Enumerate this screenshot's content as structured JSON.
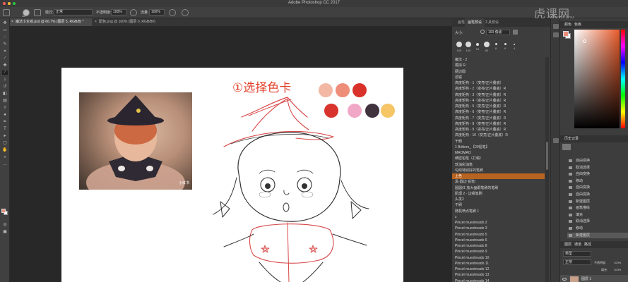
{
  "window": {
    "title": "Adobe Photoshop CC 2017",
    "traffic_colors": [
      "#fe5f57",
      "#febc2e",
      "#28c840"
    ]
  },
  "options_bar": {
    "brush_size": "100",
    "mode_label": "模式:",
    "mode_value": "正常",
    "opacity_label": "不透明度:",
    "opacity_value": "100%",
    "flow_label": "流量:",
    "flow_value": "100%"
  },
  "watermark": {
    "text": "虎课网",
    "sub": "HUKE88.COM"
  },
  "tabs": [
    {
      "label": "魔法小女孩.psd @ 66.7% (图层 5, RGB/8) *",
      "active": true
    },
    {
      "label": "配色.png @ 100% (图层 0, RGB/8#)",
      "active": false
    }
  ],
  "canvas": {
    "heading": "①选择色卡",
    "photo_caption": "小红书",
    "color_cards": [
      "#f2b8a4",
      "#ee8d78",
      "#d9322a",
      "#d8332c",
      "#f1a8c6",
      "#40333e",
      "#f6c565"
    ]
  },
  "brush_panel": {
    "tabs": [
      {
        "label": "画笔",
        "active": false
      },
      {
        "label": "画笔预设",
        "active": true
      },
      {
        "label": "工具预设",
        "active": false
      }
    ],
    "size_label": "大小:",
    "size_value": "100 像素",
    "presets": [
      "100",
      "100",
      "15",
      "60",
      "8",
      "9",
      "4"
    ],
    "items": [
      "魔法 - 2",
      "模拟 R",
      "硬边圆",
      "滤镜",
      "高度矩构 - 1（变亮/正片叠底）",
      "高度矩构 - 2（变亮/正片叠底）R",
      "高度矩构 - 3（变亮/正片叠底）R",
      "高度矩构 - 4（变亮/正片叠底）R",
      "高度矩构 - 5（变亮/正片叠底）R",
      "高度矩构 - 6（变亮/正片叠底）R",
      "高度矩构 - 7（变亮/正片叠底）R",
      "高度矩构 - 8（变亮/正片叠底）R",
      "高度矩构 - 9（变亮/正片叠底）R",
      "高度矩构 - 10（变亮/正片叠底）R",
      "干刷",
      "1 Brittern_【29铅笔】",
      "MAOMAO",
      "细密铅笔（打稿）",
      "软油彩油笔",
      "勾线特别好的笔刷",
      "上色",
      "黑-圆边 铅笔!",
      "圆圆红 放大面跟笔刷的笔刷",
      "肌理 2 - 边缘笔刷",
      "头发2",
      "干刷",
      "随机喷点笔刷 1",
      "z",
      "Pincel muestreado 2",
      "Pincel muestreado 3",
      "Pincel muestreado 5",
      "Pincel muestreado 6",
      "Pincel muestreado 8",
      "Pincel muestreado 9",
      "Pincel muestreado 10",
      "Pincel muestreado 11",
      "Pincel muestreado 12",
      "Pincel muestreado 13",
      "Pincel muestreado 14",
      "Pincel muestreado 15"
    ],
    "selected_index": 20
  },
  "color_panel": {
    "tabs": [
      "颜色",
      "色板"
    ],
    "foreground": "#e98e7c",
    "background": "#ffffff"
  },
  "history_panel": {
    "title": "历史记录",
    "items": [
      "自由变换",
      "取消选择",
      "自由变换",
      "移动",
      "自由变换",
      "自由变换",
      "新建图层",
      "画笔描绘",
      "填充",
      "取消选择",
      "移动",
      "新建图层"
    ],
    "selected_index": 11
  },
  "layers_panel": {
    "tabs": [
      "图层",
      "通道",
      "路径"
    ],
    "kind_label": "类型",
    "blend_mode": "正常",
    "opacity_label": "不透明度:",
    "opacity_value": "100%",
    "fill_label": "填充:",
    "fill_value": "100%",
    "top_layer": "图层 1"
  }
}
